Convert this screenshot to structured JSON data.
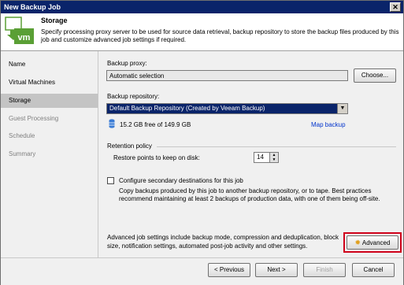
{
  "window": {
    "title": "New Backup Job",
    "close_glyph": "✕"
  },
  "header": {
    "title": "Storage",
    "description": "Specify processing proxy server to be used for source data retrieval, backup repository to store the backup files produced by this job and customize advanced job settings if required.",
    "icon": "veeam-vm-icon",
    "icon_text": "vm"
  },
  "nav": {
    "items": [
      {
        "label": "Name",
        "state": "normal"
      },
      {
        "label": "Virtual Machines",
        "state": "normal"
      },
      {
        "label": "Storage",
        "state": "selected"
      },
      {
        "label": "Guest Processing",
        "state": "disabled"
      },
      {
        "label": "Schedule",
        "state": "disabled"
      },
      {
        "label": "Summary",
        "state": "disabled"
      }
    ]
  },
  "proxy": {
    "label": "Backup proxy:",
    "value": "Automatic selection",
    "button": "Choose..."
  },
  "repository": {
    "label": "Backup repository:",
    "selected": "Default Backup Repository (Created by Veeam Backup)",
    "free_space": "15.2 GB free of 149.9 GB",
    "map_link": "Map backup"
  },
  "retention": {
    "group_label": "Retention policy",
    "label": "Restore points to keep on disk:",
    "value": "14"
  },
  "secondary": {
    "checkbox_label": "Configure secondary destinations for this job",
    "checked": false,
    "description": "Copy backups produced by this job to another backup repository, or to tape. Best practices recommend maintaining at least 2 backups of production data, with one of them being off-site."
  },
  "advanced": {
    "description": "Advanced job settings include backup mode, compression and deduplication, block size, notification settings, automated post-job activity and other settings.",
    "button": "Advanced",
    "highlight_color": "#d0021b"
  },
  "footer": {
    "previous": "< Previous",
    "next": "Next >",
    "finish": "Finish",
    "cancel": "Cancel"
  },
  "colors": {
    "titlebar": "#0a246a",
    "selection": "#0a246a",
    "link": "#0033cc",
    "icon_green": "#5a9f35"
  }
}
